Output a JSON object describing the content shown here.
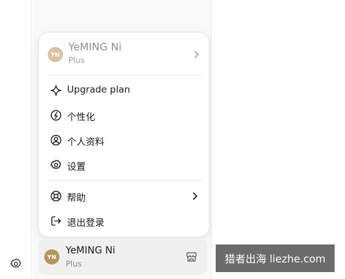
{
  "menu": {
    "account": {
      "initials": "YN",
      "name": "YeMING Ni",
      "plan": "Plus"
    },
    "items": [
      {
        "label": "Upgrade plan",
        "icon": "sparkle-icon"
      },
      {
        "label": "个性化",
        "icon": "personalize-icon"
      },
      {
        "label": "个人资料",
        "icon": "user-circle-icon"
      },
      {
        "label": "设置",
        "icon": "gear-icon"
      },
      {
        "label": "帮助",
        "icon": "lifebuoy-icon",
        "has_submenu": true
      },
      {
        "label": "退出登录",
        "icon": "logout-icon"
      }
    ]
  },
  "profile": {
    "initials": "YN",
    "name": "YeMING Ni",
    "plan": "Plus"
  },
  "watermark": {
    "text": "猎者出海 liezhe.com"
  },
  "colors": {
    "menu_avatar": "#d8c4a2",
    "profile_avatar": "#b8955c",
    "watermark_bg": "#6b6b6b"
  }
}
